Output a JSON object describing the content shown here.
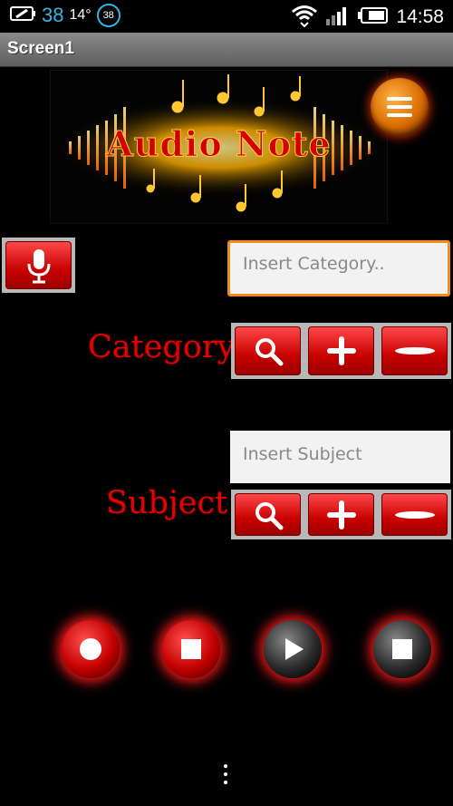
{
  "status_bar": {
    "battery_level": "38",
    "temperature": "14°",
    "notification_count": "38",
    "time": "14:58",
    "icons": [
      "battery-charging-icon",
      "wifi-icon",
      "signal-icon",
      "battery-icon"
    ]
  },
  "title_bar": {
    "title": "Screen1"
  },
  "logo": {
    "text": "Audio Note"
  },
  "menu": {
    "icon": "hamburger-menu-icon"
  },
  "mic": {
    "icon": "microphone-icon"
  },
  "category": {
    "label": "Category",
    "placeholder": "Insert Category..",
    "buttons": [
      "search-icon",
      "plus-icon",
      "minus-icon"
    ]
  },
  "subject": {
    "label": "Subject",
    "placeholder": "Insert Subject",
    "buttons": [
      "search-icon",
      "plus-icon",
      "minus-icon"
    ]
  },
  "playback": {
    "buttons": [
      "record-icon",
      "stop-icon",
      "play-icon",
      "stop-play-icon"
    ]
  },
  "colors": {
    "accent_red": "#c80000",
    "focus_orange": "#f28b1d",
    "status_blue": "#33b5e5"
  }
}
